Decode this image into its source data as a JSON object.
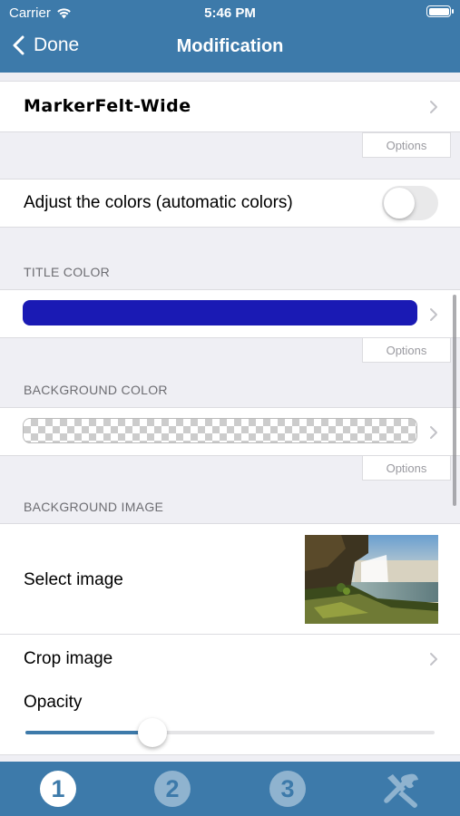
{
  "status": {
    "carrier": "Carrier",
    "time": "5:46 PM"
  },
  "nav": {
    "back_label": "Done",
    "title": "Modification"
  },
  "font": {
    "name": "MarkerFelt-Wide",
    "options_label": "Options"
  },
  "adjust_colors": {
    "label": "Adjust the colors (automatic colors)",
    "enabled": false
  },
  "title_color": {
    "header": "TITLE COLOR",
    "color": "#1a1ab4",
    "options_label": "Options"
  },
  "background_color": {
    "header": "BACKGROUND COLOR",
    "color": "transparent",
    "options_label": "Options"
  },
  "background_image": {
    "header": "BACKGROUND IMAGE",
    "select_label": "Select image",
    "crop_label": "Crop image",
    "opacity_label": "Opacity",
    "opacity_value": 0.31
  },
  "tabs": [
    {
      "label": "1",
      "active": true
    },
    {
      "label": "2",
      "active": false
    },
    {
      "label": "3",
      "active": false
    },
    {
      "label": "",
      "icon": "tools-icon",
      "active": false
    }
  ],
  "colors": {
    "accent": "#3d7aaa",
    "title_color_swatch": "#1a1ab4"
  }
}
